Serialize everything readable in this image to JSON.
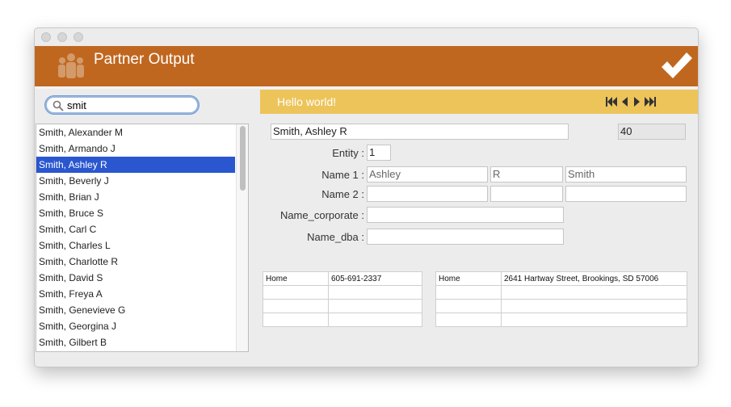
{
  "window": {
    "title": "Partner Output"
  },
  "search": {
    "value": "smit",
    "placeholder": ""
  },
  "list": {
    "items": [
      "Smith, Alexander M",
      "Smith, Armando J",
      "Smith, Ashley R",
      "Smith, Beverly J",
      "Smith, Brian J",
      "Smith, Bruce S",
      "Smith, Carl C",
      "Smith, Charles L",
      "Smith, Charlotte R",
      "Smith, David S",
      "Smith, Freya A",
      "Smith, Genevieve G",
      "Smith, Georgina J",
      "Smith, Gilbert B"
    ],
    "selected": "Smith, Ashley R"
  },
  "banner": {
    "text": "Hello world!"
  },
  "record": {
    "full_name": "Smith, Ashley R",
    "id": "40",
    "entity_label": "Entity :",
    "entity_value": "1",
    "name1_label": "Name 1 :",
    "name1_first": "Ashley",
    "name1_middle": "R",
    "name1_last": "Smith",
    "name2_label": "Name 2 :",
    "name2_first": "",
    "name2_middle": "",
    "name2_last": "",
    "corporate_label": "Name_corporate :",
    "corporate_value": "",
    "dba_label": "Name_dba :",
    "dba_value": ""
  },
  "phones": {
    "rows": [
      [
        "Home",
        "605-691-2337"
      ],
      [
        "",
        ""
      ],
      [
        "",
        ""
      ],
      [
        "",
        ""
      ]
    ]
  },
  "addresses": {
    "rows": [
      [
        "Home",
        "2641 Hartway Street, Brookings, SD 57006"
      ],
      [
        "",
        ""
      ],
      [
        "",
        ""
      ],
      [
        "",
        ""
      ]
    ]
  },
  "colors": {
    "header": "#c0671f",
    "banner": "#ecc45a",
    "selection": "#2a57cf"
  },
  "icons": {
    "logo": "people-group-icon",
    "confirm": "checkmark-icon",
    "search": "search-icon"
  }
}
